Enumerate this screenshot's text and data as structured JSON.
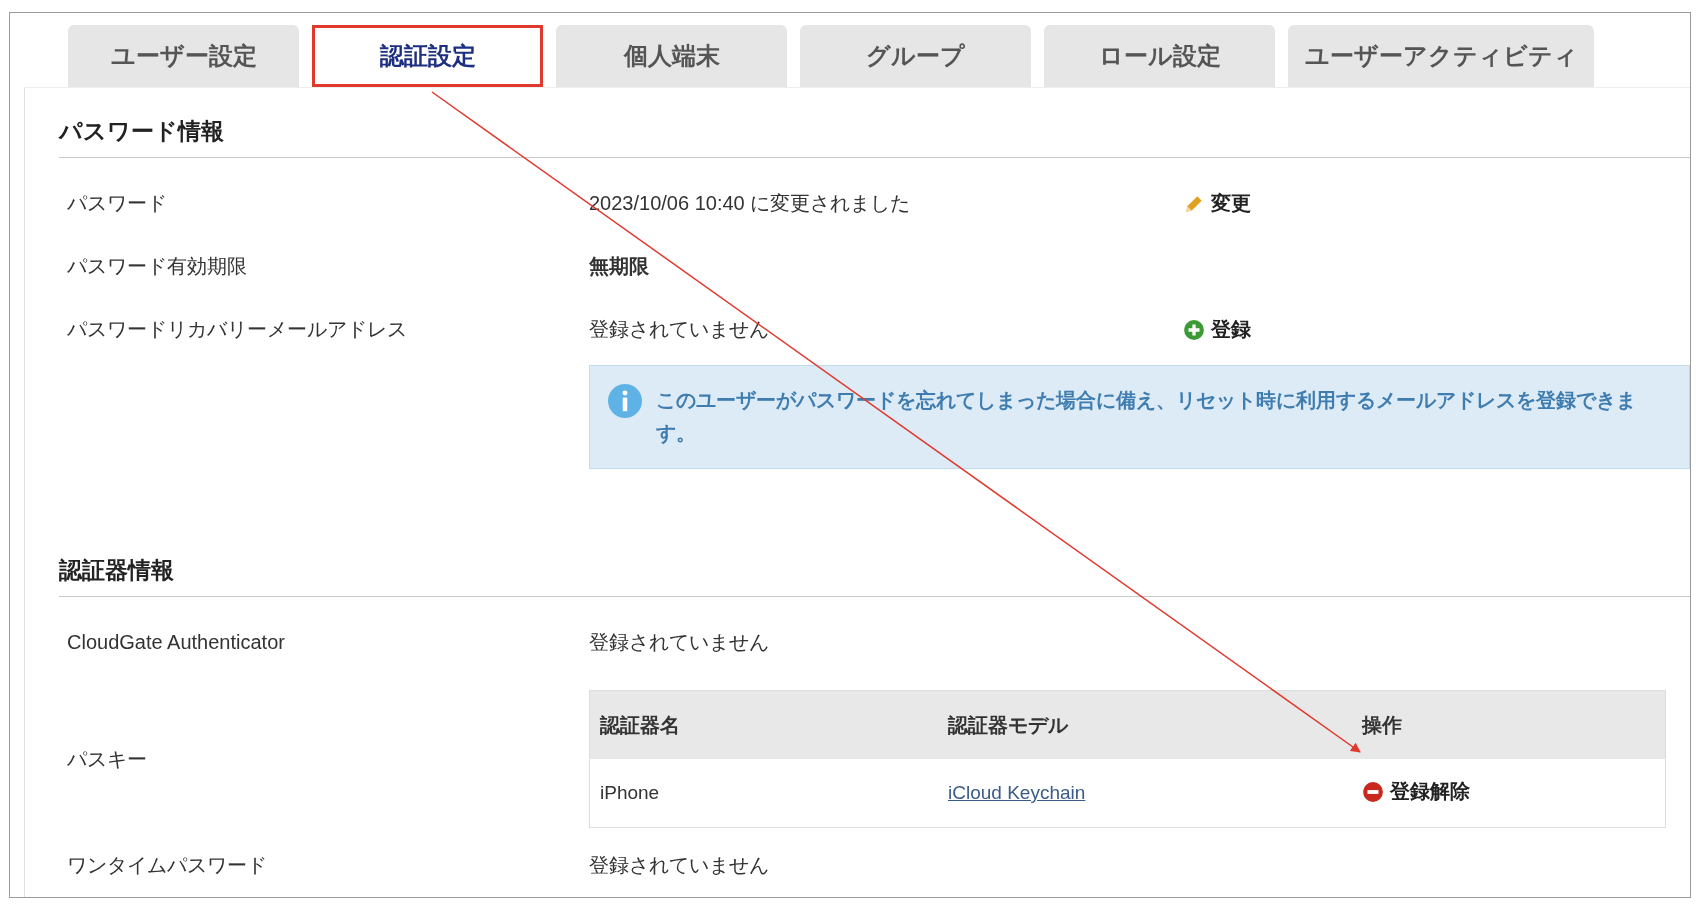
{
  "tabs": [
    {
      "label": "ユーザー設定",
      "selected": false
    },
    {
      "label": "認証設定",
      "selected": true
    },
    {
      "label": "個人端末",
      "selected": false
    },
    {
      "label": "グループ",
      "selected": false
    },
    {
      "label": "ロール設定",
      "selected": false
    },
    {
      "label": "ユーザーアクティビティ",
      "selected": false
    }
  ],
  "sections": [
    {
      "title": "パスワード情報",
      "rows": [
        {
          "kind": "field",
          "label": "パスワード",
          "value": "2023/10/06 10:40 に変更されました",
          "bold": false,
          "action": {
            "kind": "edit",
            "label": "変更"
          }
        },
        {
          "kind": "field",
          "label": "パスワード有効期限",
          "value": "無期限",
          "bold": true
        },
        {
          "kind": "field",
          "label": "パスワードリカバリーメールアドレス",
          "value": "登録されていません",
          "bold": false,
          "action": {
            "kind": "add",
            "label": "登録"
          }
        },
        {
          "kind": "notice",
          "text": "このユーザーがパスワードを忘れてしまった場合に備え、リセット時に利用するメールアドレスを登録できます。"
        }
      ]
    },
    {
      "title": "認証器情報",
      "rows": [
        {
          "kind": "field",
          "label": "CloudGate Authenticator",
          "value": "登録されていません",
          "bold": false
        },
        {
          "kind": "table",
          "label": "パスキー",
          "columns": [
            "認証器名",
            "認証器モデル",
            "操作"
          ],
          "rows": [
            {
              "name": "iPhone",
              "model": "iCloud Keychain",
              "action": {
                "kind": "remove",
                "label": "登録解除"
              }
            }
          ]
        },
        {
          "kind": "field",
          "label": "ワンタイムパスワード",
          "value": "登録されていません",
          "bold": false
        }
      ]
    }
  ]
}
